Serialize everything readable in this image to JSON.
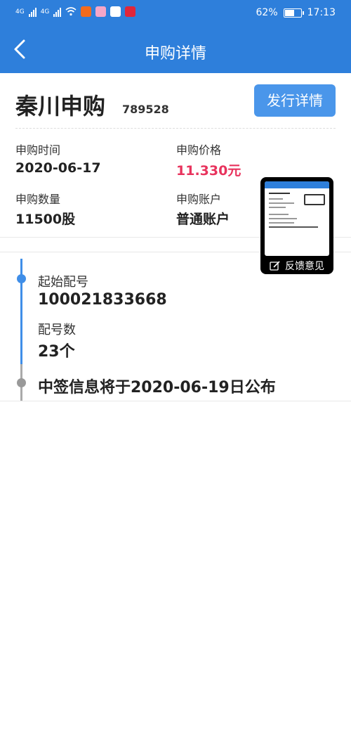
{
  "status_bar": {
    "network1": "4G",
    "network2": "4G",
    "battery": "62%",
    "battery_level": 0.62,
    "time": "17:13"
  },
  "nav": {
    "title": "申购详情"
  },
  "stock": {
    "name": "秦川申购",
    "code": "789528",
    "issue_button": "发行详情"
  },
  "details": {
    "time_label": "申购时间",
    "time_value": "2020-06-17",
    "price_label": "申购价格",
    "price_value": "11.330元",
    "qty_label": "申购数量",
    "qty_value": "11500股",
    "account_label": "申购账户",
    "account_value": "普通账户"
  },
  "allotment": {
    "start_label": "起始配号",
    "start_value": "100021833668",
    "count_label": "配号数",
    "count_value": "23个",
    "notice": "中签信息将于2020-06-19日公布"
  },
  "feedback": {
    "label": "反馈意见"
  },
  "colors": {
    "header": "#2e7fdb",
    "button": "#4a96ea",
    "price": "#e8335d",
    "timeline": "#3f8ee8"
  }
}
